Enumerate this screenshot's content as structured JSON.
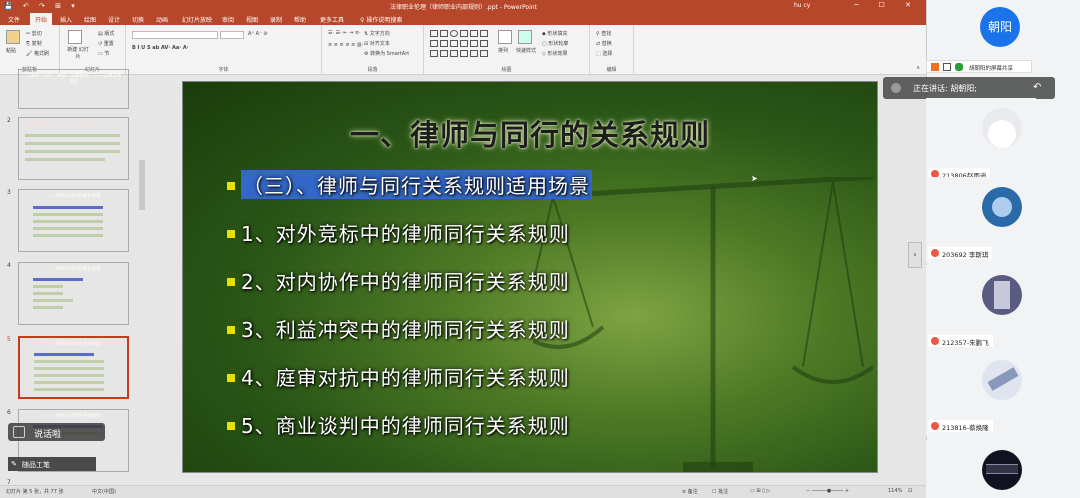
{
  "titlebar": {
    "quick": "💾 ↶ ↷ ⊞ ▾",
    "title": "法律职业伦理（律师职业内部规则）.ppt - PowerPoint",
    "user": "hu cy"
  },
  "tabs": [
    "文件",
    "开始",
    "插入",
    "绘图",
    "设计",
    "切换",
    "动画",
    "幻灯片放映",
    "审阅",
    "视图",
    "录制",
    "帮助",
    "更多工具",
    "操作说明搜索"
  ],
  "share_btn": "共享",
  "ribbon": {
    "clipboard": "剪贴板",
    "paste": "粘贴",
    "cut": "剪切",
    "copy": "复制",
    "fmt": "格式刷",
    "new_slide": "新建\n幻灯片",
    "reuse": "重用\n幻灯片",
    "slides": "幻灯片",
    "layout": "版式",
    "reset": "重置",
    "section": "节",
    "font": "字体",
    "paragraph": "段落",
    "text_dir": "文字方向",
    "align_text": "对齐文本",
    "smartart": "转换为 SmartArt",
    "drawing": "绘图",
    "arrange": "排列",
    "quick_styles": "快速样式",
    "fill": "形状填充",
    "outline": "形状轮廓",
    "effects": "形状效果",
    "find": "查找",
    "replace": "替换",
    "select": "选择",
    "editing": "编辑"
  },
  "thumbs": [
    {
      "num": "",
      "title": "（律师—同行—律所—法律服务）\n——法律实务课堂"
    },
    {
      "num": "2",
      "title": "思考下面几个案例，你认为正确与否？"
    },
    {
      "num": "3",
      "title": "一、律师与同行的关系规则"
    },
    {
      "num": "4",
      "title": "一、律师与同行的关系规则"
    },
    {
      "num": "5",
      "title": "一、律师与同行的关系规则"
    },
    {
      "num": "6",
      "title": "一、律师与同行的关系规则"
    },
    {
      "num": "7",
      "title": ""
    }
  ],
  "slide": {
    "title": "一、律师与同行的关系规则",
    "items": [
      "（三）、律师与同行关系规则适用场景",
      "1、对外竞标中的律师同行关系规则",
      "2、对内协作中的律师同行关系规则",
      "3、利益冲突中的律师同行关系规则",
      "4、庭审对抗中的律师同行关系规则",
      "5、商业谈判中的律师同行关系规则"
    ]
  },
  "status": {
    "slide": "幻灯片 第 5 张，共 77 张",
    "lang": "中文(中国)",
    "notes": "备注",
    "comments": "批注",
    "zoom": "114%"
  },
  "toast": "说话啦",
  "toolbar": "随品工笔",
  "meeting": {
    "me": "朝阳",
    "sharing": "胡朝阳的屏幕共享",
    "speaking": "正在讲话: 胡朝阳;",
    "participants": [
      {
        "name": "213806赵雨迪",
        "color": "#d0d4da"
      },
      {
        "name": "203692 李斯琪",
        "color": "#2a6aa8"
      },
      {
        "name": "212357-朱鹏飞",
        "color": "#5a5b80"
      },
      {
        "name": "213816-蔡焕隆",
        "color": "#9aa6c0"
      },
      {
        "name": "",
        "color": "#223"
      }
    ]
  },
  "colors": {
    "accent": "#b7472a",
    "highlight": "#3367c8",
    "bullet": "#e8e000"
  }
}
